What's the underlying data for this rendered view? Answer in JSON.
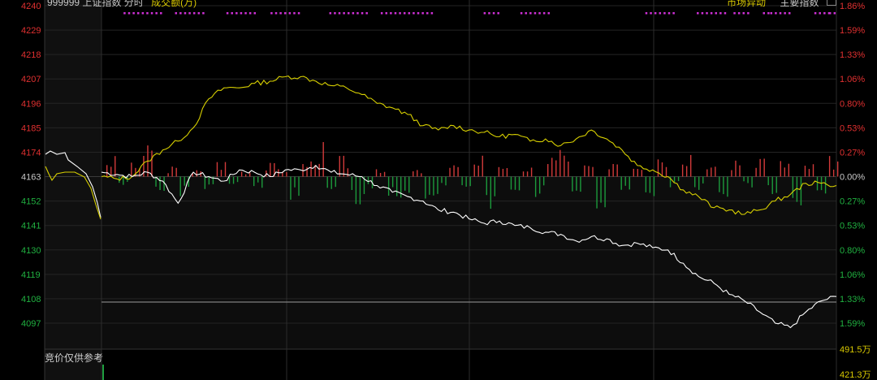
{
  "header": {
    "code": "999999",
    "index_name": "上证指数",
    "mode": "分时",
    "indicator": "成交额(万)",
    "market_tab": "市场异动",
    "main_index_tab": "主要指数"
  },
  "price_axis": [
    "4240",
    "4229",
    "4218",
    "4207",
    "4196",
    "4185",
    "4174",
    "4163",
    "4152",
    "4141",
    "4130",
    "4119",
    "4108",
    "4097"
  ],
  "pct_axis": [
    "1.86%",
    "1.59%",
    "1.33%",
    "1.06%",
    "0.80%",
    "0.53%",
    "0.27%",
    "0.00%",
    "0.27%",
    "0.53%",
    "0.80%",
    "1.06%",
    "1.33%",
    "1.59%"
  ],
  "volume_axis": [
    "491.5万",
    "421.3万"
  ],
  "auction_label": "竞价仅供参考",
  "colors": {
    "background": "#000000",
    "price_line": "#ffffff",
    "avg_line": "#d8d000",
    "up_bar": "#d23a3a",
    "down_bar": "#1c9a3c",
    "grid": "#2b2b2b",
    "marker": "#d030d8",
    "axis_up": "#e03030",
    "axis_down": "#20b040",
    "axis_flat": "#c8c8c8",
    "axis_volume": "#d8c800"
  },
  "chart_data": {
    "type": "line",
    "series": [
      {
        "name": "",
        "color": "#ffffff",
        "x": [
          0,
          5,
          10,
          15,
          20,
          25,
          30,
          35,
          40,
          45,
          50,
          55,
          60,
          65,
          70,
          75,
          80,
          85,
          90,
          95,
          100,
          105,
          110,
          115,
          120,
          125,
          130,
          135,
          140,
          145,
          150,
          155,
          160,
          165,
          170,
          175,
          180,
          185,
          190,
          195,
          200,
          205,
          210,
          215,
          220,
          225,
          230,
          235,
          240
        ],
        "values": [
          4165,
          4164,
          4163,
          4165,
          4161,
          4151,
          4165,
          4163,
          4161,
          4166,
          4165,
          4163,
          4166,
          4166,
          4168,
          4165,
          4164,
          4163,
          4159,
          4156,
          4154,
          4152,
          4148,
          4147,
          4144,
          4142,
          4143,
          4141,
          4140,
          4138,
          4137,
          4134,
          4136,
          4135,
          4132,
          4133,
          4131,
          4130,
          4124,
          4118,
          4115,
          4110,
          4107,
          4102,
          4097,
          4095,
          4102,
          4107,
          4109
        ]
      },
      {
        "name": "",
        "color": "#d8d000",
        "x": [
          0,
          5,
          10,
          15,
          20,
          25,
          30,
          35,
          40,
          45,
          50,
          55,
          60,
          65,
          70,
          75,
          80,
          85,
          90,
          95,
          100,
          105,
          110,
          115,
          120,
          125,
          130,
          135,
          140,
          145,
          150,
          155,
          160,
          165,
          170,
          175,
          180,
          185,
          190,
          195,
          200,
          205,
          210,
          215,
          220,
          225,
          230,
          235,
          240
        ],
        "values": [
          4163,
          4162,
          4163,
          4170,
          4175,
          4179,
          4185,
          4198,
          4203,
          4203,
          4205,
          4206,
          4208,
          4208,
          4206,
          4204,
          4203,
          4200,
          4196,
          4194,
          4191,
          4186,
          4184,
          4186,
          4184,
          4183,
          4181,
          4182,
          4179,
          4180,
          4177,
          4180,
          4184,
          4180,
          4175,
          4168,
          4166,
          4163,
          4157,
          4154,
          4149,
          4148,
          4146,
          4148,
          4152,
          4155,
          4160,
          4160,
          4159
        ]
      }
    ],
    "volume_bars": [
      {
        "dir": "up",
        "v": 0.6
      },
      {
        "dir": "down",
        "v": 0.3
      },
      {
        "dir": "up",
        "v": 0.4
      },
      {
        "dir": "up",
        "v": 0.9
      },
      {
        "dir": "down",
        "v": 0.5
      },
      {
        "dir": "up",
        "v": 0.3
      },
      {
        "dir": "down",
        "v": 0.6
      },
      {
        "dir": "up",
        "v": 0.2
      },
      {
        "dir": "down",
        "v": 0.4
      },
      {
        "dir": "up",
        "v": 0.5
      },
      {
        "dir": "down",
        "v": 0.3
      },
      {
        "dir": "up",
        "v": 0.2
      },
      {
        "dir": "down",
        "v": 0.5
      },
      {
        "dir": "up",
        "v": 0.4
      },
      {
        "dir": "up",
        "v": 0.3
      },
      {
        "dir": "down",
        "v": 0.7
      },
      {
        "dir": "up",
        "v": 0.5
      },
      {
        "dir": "up",
        "v": 1.0
      },
      {
        "dir": "down",
        "v": 0.4
      },
      {
        "dir": "up",
        "v": 0.6
      },
      {
        "dir": "down",
        "v": 0.8
      },
      {
        "dir": "down",
        "v": 0.5
      },
      {
        "dir": "up",
        "v": 0.3
      },
      {
        "dir": "down",
        "v": 0.9
      },
      {
        "dir": "down",
        "v": 0.6
      },
      {
        "dir": "up",
        "v": 0.2
      },
      {
        "dir": "down",
        "v": 0.7
      },
      {
        "dir": "down",
        "v": 0.5
      },
      {
        "dir": "up",
        "v": 0.4
      },
      {
        "dir": "down",
        "v": 0.3
      },
      {
        "dir": "up",
        "v": 0.8
      },
      {
        "dir": "down",
        "v": 1.1
      },
      {
        "dir": "up",
        "v": 0.5
      },
      {
        "dir": "down",
        "v": 0.4
      },
      {
        "dir": "up",
        "v": 0.3
      },
      {
        "dir": "down",
        "v": 0.6
      },
      {
        "dir": "up",
        "v": 0.7
      },
      {
        "dir": "up",
        "v": 0.9
      },
      {
        "dir": "down",
        "v": 0.5
      },
      {
        "dir": "up",
        "v": 0.4
      },
      {
        "dir": "down",
        "v": 0.9
      },
      {
        "dir": "up",
        "v": 0.6
      },
      {
        "dir": "down",
        "v": 0.7
      },
      {
        "dir": "up",
        "v": 0.5
      },
      {
        "dir": "down",
        "v": 1.2
      },
      {
        "dir": "up",
        "v": 0.8
      },
      {
        "dir": "down",
        "v": 0.4
      },
      {
        "dir": "up",
        "v": 0.9
      },
      {
        "dir": "down",
        "v": 0.6
      },
      {
        "dir": "up",
        "v": 0.3
      },
      {
        "dir": "down",
        "v": 0.8
      },
      {
        "dir": "up",
        "v": 0.5
      },
      {
        "dir": "down",
        "v": 0.3
      },
      {
        "dir": "up",
        "v": 0.7
      },
      {
        "dir": "down",
        "v": 0.6
      },
      {
        "dir": "up",
        "v": 0.5
      },
      {
        "dir": "down",
        "v": 0.9
      },
      {
        "dir": "up",
        "v": 0.4
      },
      {
        "dir": "down",
        "v": 0.5
      },
      {
        "dir": "up",
        "v": 0.6
      }
    ],
    "marker_groups": [
      {
        "from": 0.03,
        "to": 0.08
      },
      {
        "from": 0.1,
        "to": 0.14
      },
      {
        "from": 0.17,
        "to": 0.21
      },
      {
        "from": 0.23,
        "to": 0.27
      },
      {
        "from": 0.31,
        "to": 0.36
      },
      {
        "from": 0.38,
        "to": 0.45
      },
      {
        "from": 0.52,
        "to": 0.54
      },
      {
        "from": 0.57,
        "to": 0.61
      },
      {
        "from": 0.74,
        "to": 0.78
      },
      {
        "from": 0.81,
        "to": 0.85
      },
      {
        "from": 0.86,
        "to": 0.88
      },
      {
        "from": 0.9,
        "to": 0.91
      },
      {
        "from": 0.91,
        "to": 0.94
      },
      {
        "from": 0.97,
        "to": 0.99
      },
      {
        "from": 0.99,
        "to": 1.0
      }
    ]
  }
}
